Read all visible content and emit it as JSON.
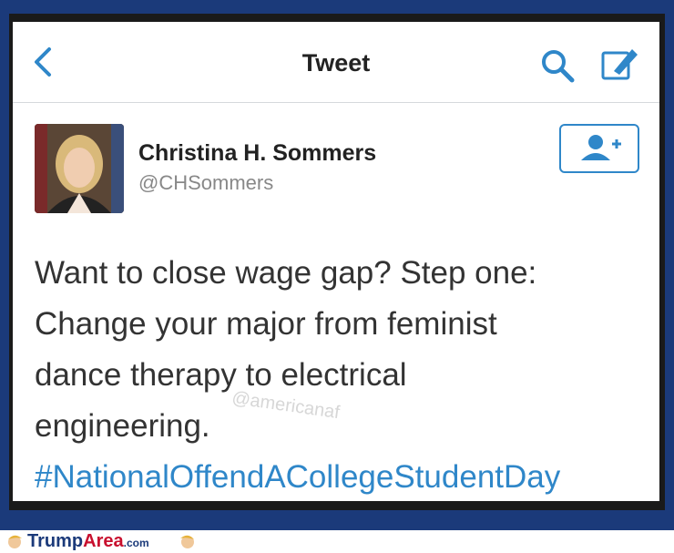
{
  "header": {
    "title": "Tweet"
  },
  "user": {
    "display_name": "Christina H. Sommers",
    "handle": "@CHSommers"
  },
  "tweet": {
    "line1": "Want to close wage gap? Step one:",
    "line2": "Change your major from feminist",
    "line3": "dance therapy to electrical",
    "line4": "engineering.",
    "hashtag": "#NationalOffendACollegeStudentDay"
  },
  "watermark": "@americanaf",
  "footer": {
    "brand_trump": "Trump",
    "brand_area": "Area",
    "brand_com": ".com"
  },
  "colors": {
    "accent": "#2f87c9",
    "frame": "#1b3a7a"
  },
  "icons": [
    "back-chevron-icon",
    "search-icon",
    "compose-icon",
    "add-user-icon",
    "avatar-photo"
  ]
}
